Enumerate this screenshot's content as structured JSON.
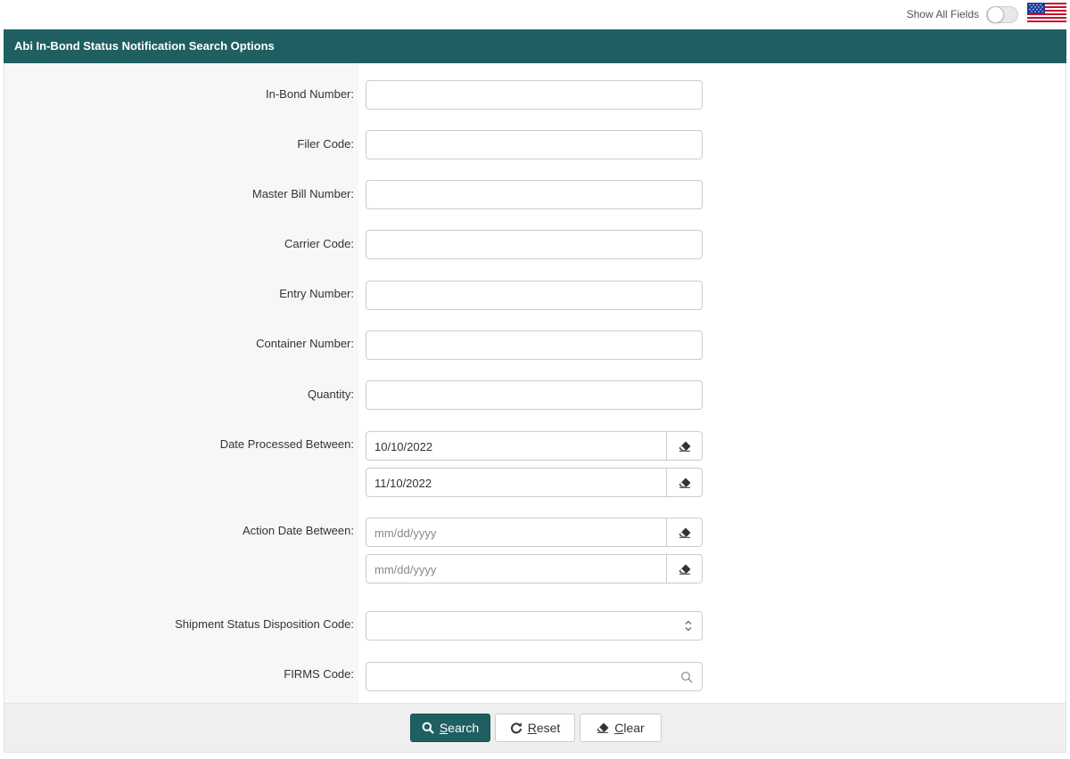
{
  "topbar": {
    "show_all_label": "Show All Fields",
    "show_all_on": false,
    "flag_icon": "us-flag-icon"
  },
  "panel": {
    "title": "Abi In-Bond Status Notification Search Options"
  },
  "fields": {
    "in_bond_number": {
      "label": "In-Bond Number:",
      "value": ""
    },
    "filer_code": {
      "label": "Filer Code:",
      "value": ""
    },
    "master_bill_number": {
      "label": "Master Bill Number:",
      "value": ""
    },
    "carrier_code": {
      "label": "Carrier Code:",
      "value": ""
    },
    "entry_number": {
      "label": "Entry Number:",
      "value": ""
    },
    "container_number": {
      "label": "Container Number:",
      "value": ""
    },
    "quantity": {
      "label": "Quantity:",
      "value": ""
    },
    "date_processed": {
      "label": "Date Processed Between:",
      "from": "10/10/2022",
      "to": "11/10/2022"
    },
    "action_date": {
      "label": "Action Date Between:",
      "from_placeholder": "mm/dd/yyyy",
      "to_placeholder": "mm/dd/yyyy"
    },
    "shipment_status": {
      "label": "Shipment Status Disposition Code:",
      "value": ""
    },
    "firms_code": {
      "label": "FIRMS Code:",
      "value": ""
    }
  },
  "buttons": {
    "search_first": "S",
    "search_rest": "earch",
    "reset_first": "R",
    "reset_rest": "eset",
    "clear_first": "C",
    "clear_rest": "lear"
  },
  "colors": {
    "header_bg": "#1f5f61",
    "primary_button": "#1f5f61"
  }
}
